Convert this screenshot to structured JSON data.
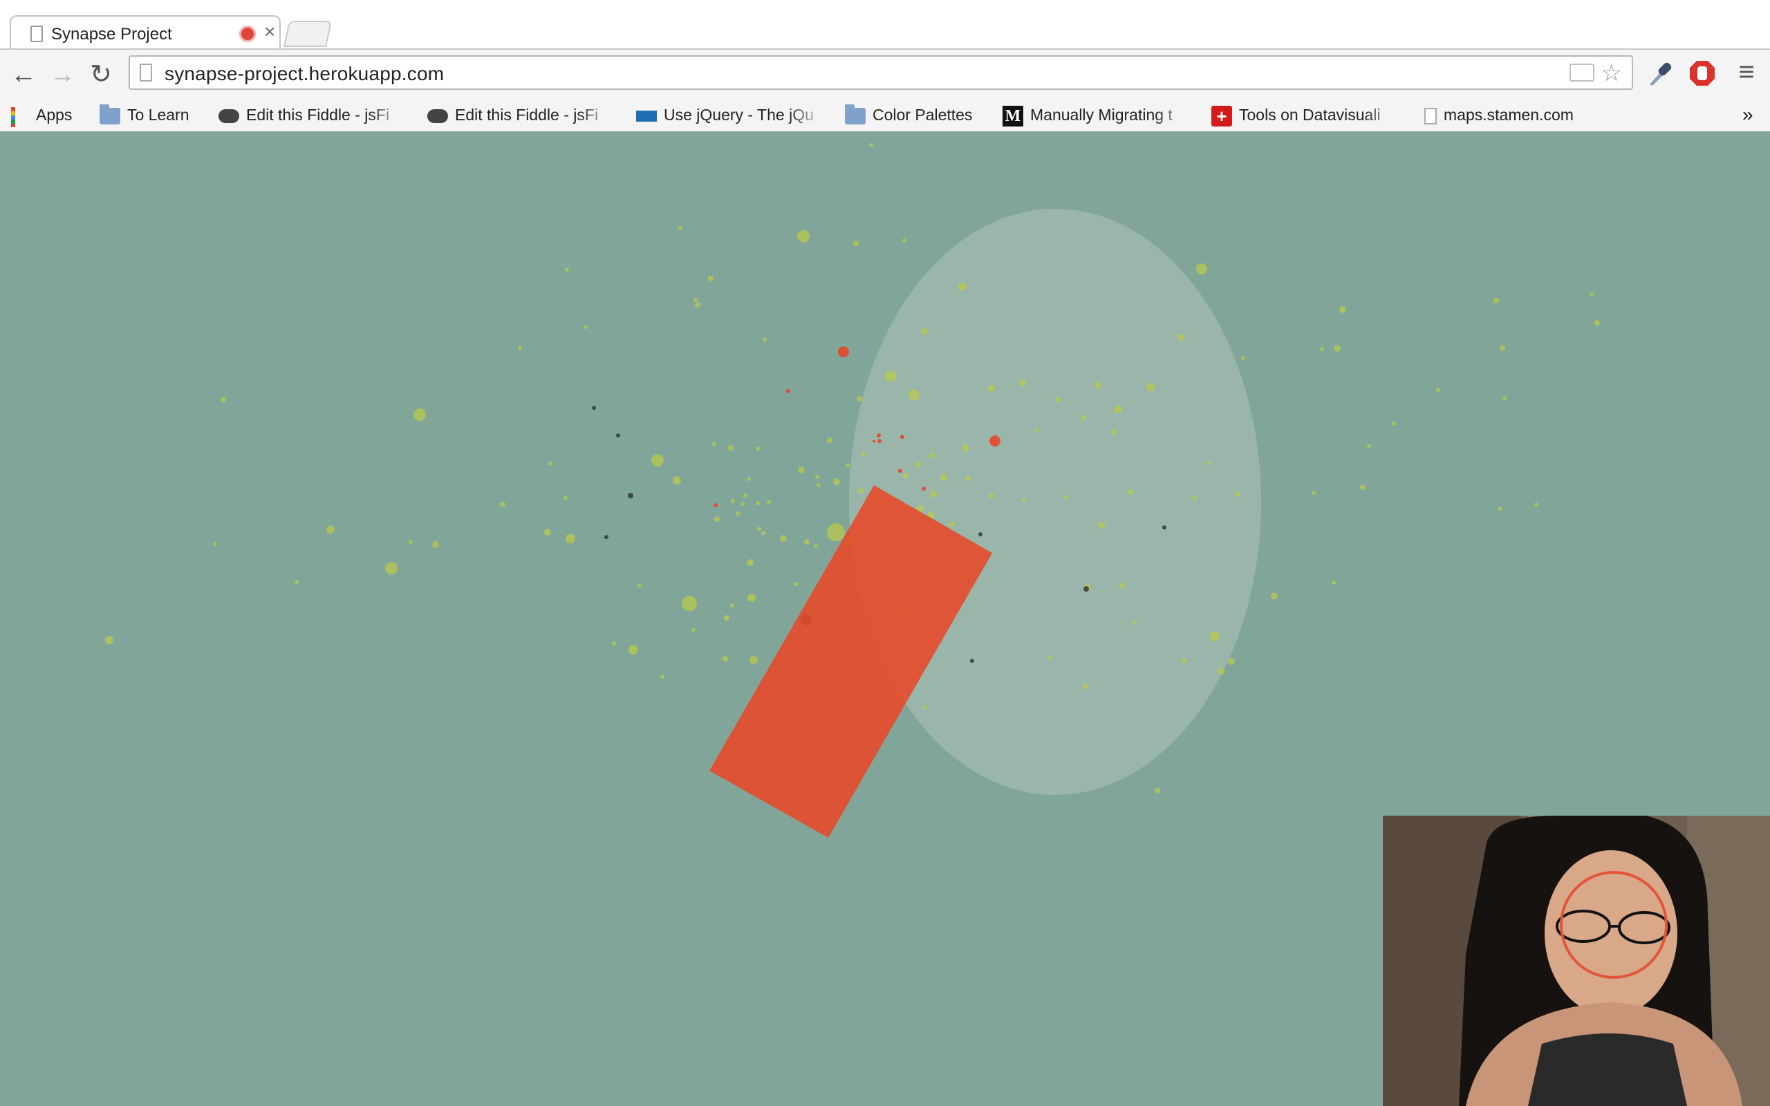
{
  "browser": {
    "tab": {
      "title": "Synapse Project",
      "close_glyph": "×"
    },
    "toolbar": {
      "back_glyph": "←",
      "forward_glyph": "→",
      "reload_glyph": "↻",
      "url": "synapse-project.herokuapp.com",
      "star_glyph": "☆",
      "menu_glyph": "≡",
      "eyedropper_icon": "eyedropper-icon",
      "adblock_icon": "adblock-icon"
    },
    "bookmarks": [
      {
        "label": "Apps",
        "icon": "apps-grid-icon"
      },
      {
        "label": "To Learn",
        "icon": "folder-icon"
      },
      {
        "label": "Edit this Fiddle - jsFi",
        "icon": "jsfiddle-cloud-icon"
      },
      {
        "label": "Edit this Fiddle - jsFi",
        "icon": "jsfiddle-cloud-icon"
      },
      {
        "label": "Use jQuery - The jQu",
        "icon": "jquery-icon"
      },
      {
        "label": "Color Palettes",
        "icon": "folder-icon"
      },
      {
        "label": "Manually Migrating t",
        "icon": "medium-m-icon"
      },
      {
        "label": "Tools on Datavisuali",
        "icon": "red-plus-icon"
      },
      {
        "label": "maps.stamen.com",
        "icon": "page-icon"
      }
    ],
    "overflow_glyph": "»"
  },
  "page": {
    "background_color": "#82a59a",
    "ellipse_color": "#a9bfb6",
    "rectangle_color": "#e64a2a",
    "particle_colors": {
      "green": "#b8c94a",
      "red": "#e5482a",
      "dark": "#3a3f3c"
    }
  },
  "webcam": {
    "tracking_circle_color": "#e2553a"
  }
}
